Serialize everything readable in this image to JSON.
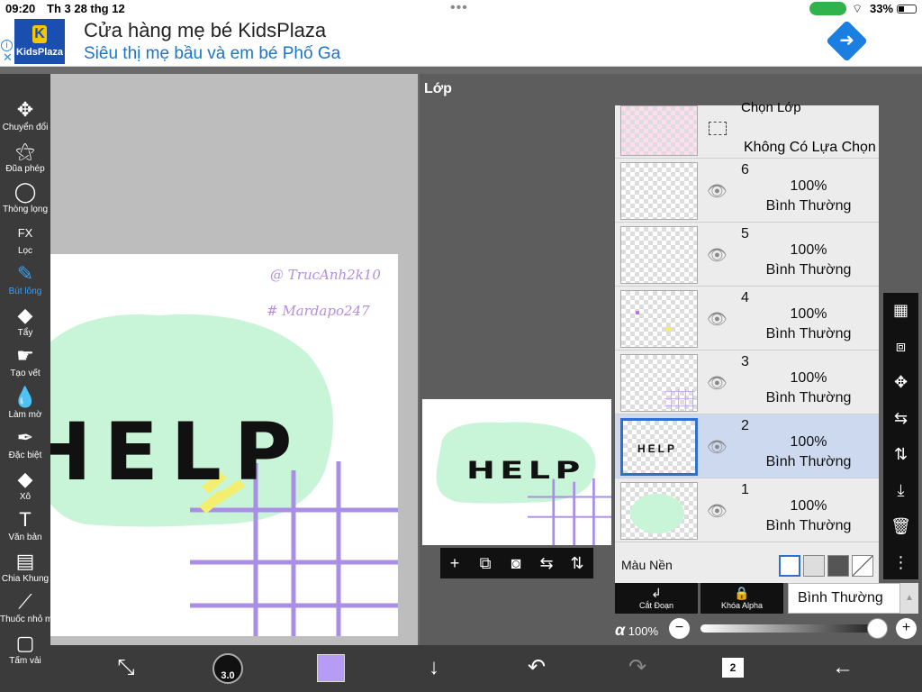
{
  "status": {
    "time": "09:20",
    "date": "Th 3 28 thg 12",
    "battery": "33%"
  },
  "ad": {
    "brand": "KidsPlaza",
    "title": "Cửa hàng mẹ bé KidsPlaza",
    "subtitle": "Siêu thị mẹ bầu và em bé Phố Ga"
  },
  "tools": [
    {
      "icon": "move-icon",
      "label": "Chuyển đổi"
    },
    {
      "icon": "magic-wand-icon",
      "label": "Đũa phép"
    },
    {
      "icon": "lasso-icon",
      "label": "Thòng lọng"
    },
    {
      "icon": "fx-icon",
      "glyph": "FX",
      "label": "Lọc"
    },
    {
      "icon": "brush-icon",
      "label": "Bút lông"
    },
    {
      "icon": "eraser-icon",
      "label": "Tẩy"
    },
    {
      "icon": "smudge-icon",
      "label": "Tạo vết"
    },
    {
      "icon": "blur-drop-icon",
      "label": "Làm mờ"
    },
    {
      "icon": "special-pen-icon",
      "label": "Đặc biệt"
    },
    {
      "icon": "fill-bucket-icon",
      "label": "Xô"
    },
    {
      "icon": "text-icon",
      "glyph": "T",
      "label": "Văn bản"
    },
    {
      "icon": "frame-divider-icon",
      "label": "Chia Khung"
    },
    {
      "icon": "eyedropper-icon",
      "label": "Thuốc nhỏ mắt"
    },
    {
      "icon": "canvas-icon",
      "label": "Tấm vải"
    }
  ],
  "canvas_art": {
    "word": "HELP",
    "signature1": "@ TrucAnh2k10",
    "signature2": "# Mardapo247"
  },
  "layers_panel": {
    "title": "Lớp",
    "selection_header": "Chọn Lớp",
    "selection_status": "Không Có Lựa Chọn",
    "layers": [
      {
        "number": "6",
        "opacity": "100%",
        "mode": "Bình Thường"
      },
      {
        "number": "5",
        "opacity": "100%",
        "mode": "Bình Thường"
      },
      {
        "number": "4",
        "opacity": "100%",
        "mode": "Bình Thường"
      },
      {
        "number": "3",
        "opacity": "100%",
        "mode": "Bình Thường"
      },
      {
        "number": "2",
        "opacity": "100%",
        "mode": "Bình Thường",
        "selected": true,
        "thumb_text": "HELP"
      },
      {
        "number": "1",
        "opacity": "100%",
        "mode": "Bình Thường"
      }
    ],
    "background_label": "Màu Nền",
    "clip_label": "Cắt Đoạn",
    "alpha_lock_label": "Khóa Alpha",
    "blend_mode": "Bình Thường",
    "alpha_symbol": "α",
    "alpha_value": "100%"
  },
  "bottom": {
    "brush_size": "3.0",
    "layer_count": "2"
  },
  "colors": {
    "brush_color": "#b79cf5",
    "blob": "#c8f5d8",
    "grid": "#a98ee6",
    "accent": "#3a9ff5"
  }
}
